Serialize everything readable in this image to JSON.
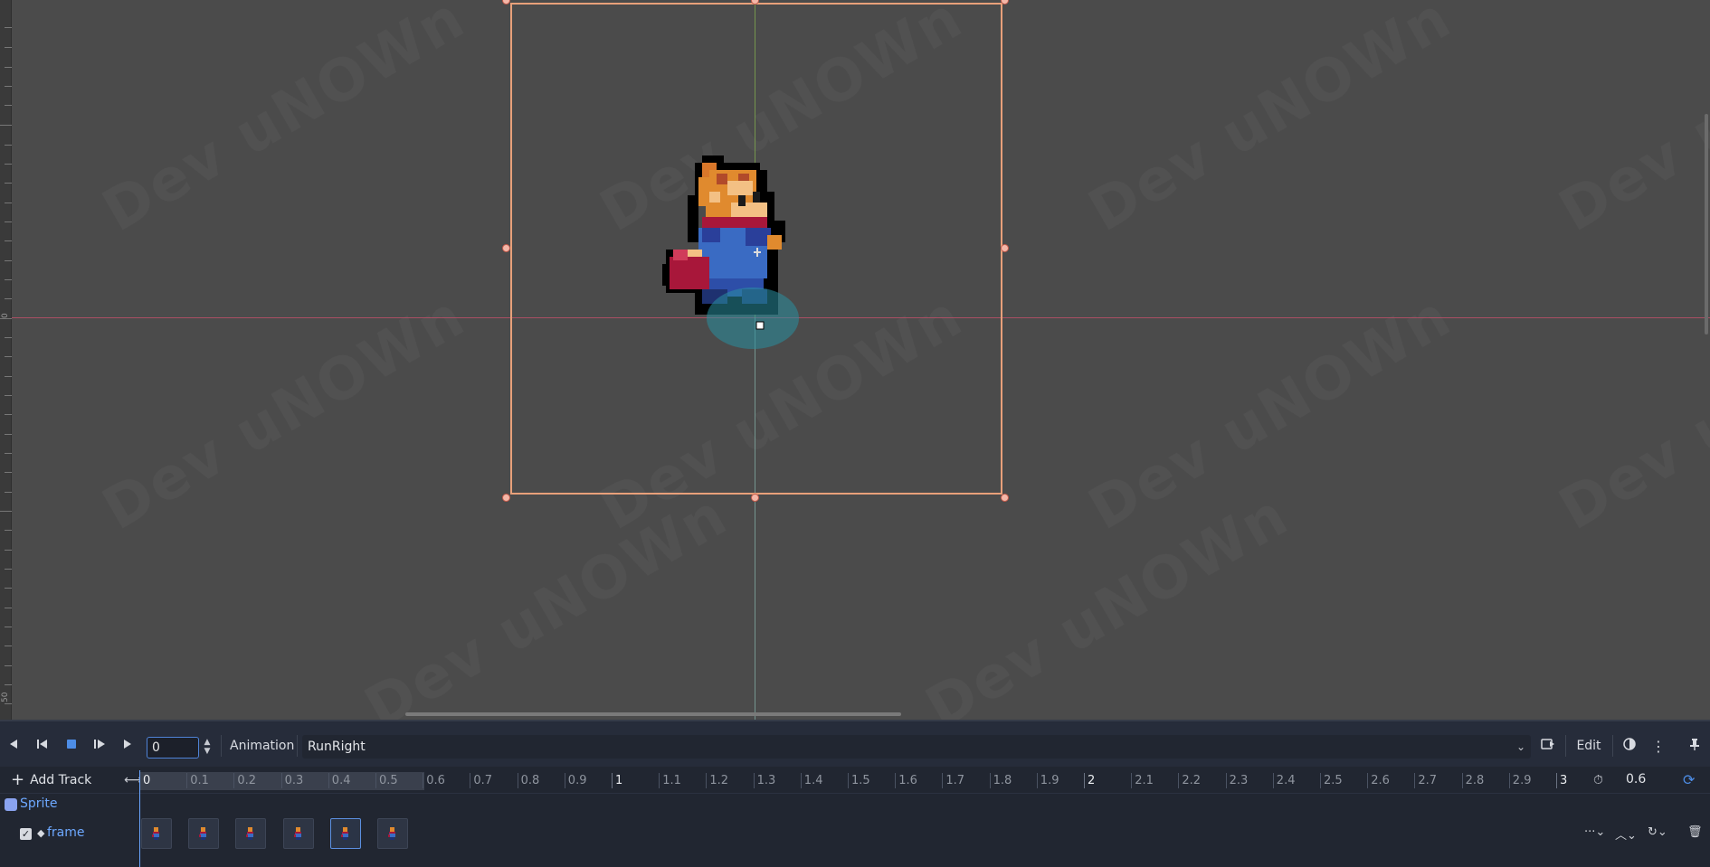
{
  "viewport": {
    "ruler_labels": [
      "0",
      "50"
    ],
    "watermark_text": "Dev uNOWn"
  },
  "animation_panel": {
    "icons": {
      "play_backwards": "play-backwards-icon",
      "play_backwards_from_end": "play-backwards-from-end-icon",
      "stop": "stop-icon",
      "play_from_start": "play-from-start-icon",
      "play": "play-icon"
    },
    "time_value": "0",
    "animation_button_label": "Animation",
    "current_animation": "RunRight",
    "edit_button_label": "Edit",
    "add_track_label": "Add Track",
    "animation_length": "0.6",
    "ruler_marks": [
      "0",
      "0.1",
      "0.2",
      "0.3",
      "0.4",
      "0.5",
      "0.6",
      "0.7",
      "0.8",
      "0.9",
      "1",
      "1.1",
      "1.2",
      "1.3",
      "1.4",
      "1.5",
      "1.6",
      "1.7",
      "1.8",
      "1.9",
      "2",
      "2.1",
      "2.2",
      "2.3",
      "2.4",
      "2.5",
      "2.6",
      "2.7",
      "2.8",
      "2.9",
      "3"
    ],
    "tracks": {
      "node_name": "Sprite",
      "property_name": "frame",
      "keyframe_count": 6,
      "selected_keyframe_index": 4
    }
  },
  "colors": {
    "accent": "#4d8de6",
    "track_label": "#6da8ff",
    "selection_box": "#e8a07a"
  }
}
